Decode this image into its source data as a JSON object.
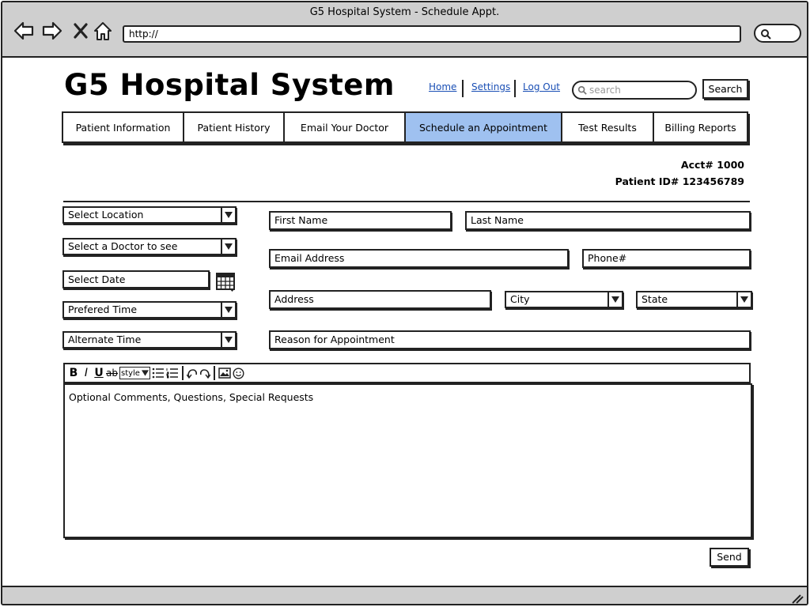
{
  "window": {
    "title": "G5 Hospital System - Schedule Appt.",
    "url": "http://"
  },
  "header": {
    "brand": "G5 Hospital System",
    "links": {
      "home": "Home",
      "settings": "Settings",
      "logout": "Log Out"
    },
    "search_placeholder": "search",
    "search_button": "Search"
  },
  "tabs": [
    {
      "label": "Patient Information",
      "active": false
    },
    {
      "label": "Patient History",
      "active": false
    },
    {
      "label": "Email Your Doctor",
      "active": false
    },
    {
      "label": "Schedule an Appointment",
      "active": true
    },
    {
      "label": "Test Results",
      "active": false
    },
    {
      "label": "Billing Reports",
      "active": false
    }
  ],
  "account": {
    "acct": "Acct# 1000",
    "patient_id": "Patient ID# 123456789"
  },
  "left_form": {
    "location": "Select Location",
    "doctor": "Select a Doctor to see",
    "date": "Select Date",
    "preferred_time": "Prefered Time",
    "alternate_time": "Alternate Time"
  },
  "right_form": {
    "first_name": "First Name",
    "last_name": "Last Name",
    "email": "Email Address",
    "phone": "Phone#",
    "address": "Address",
    "city": "City",
    "state": "State",
    "reason": "Reason for Appointment"
  },
  "editor": {
    "style_label": "style",
    "placeholder": "Optional Comments, Questions, Special Requests"
  },
  "send_button": "Send",
  "colors": {
    "active_tab": "#9fc1f0",
    "chrome": "#cfcfcf",
    "link": "#1a4fb5"
  }
}
